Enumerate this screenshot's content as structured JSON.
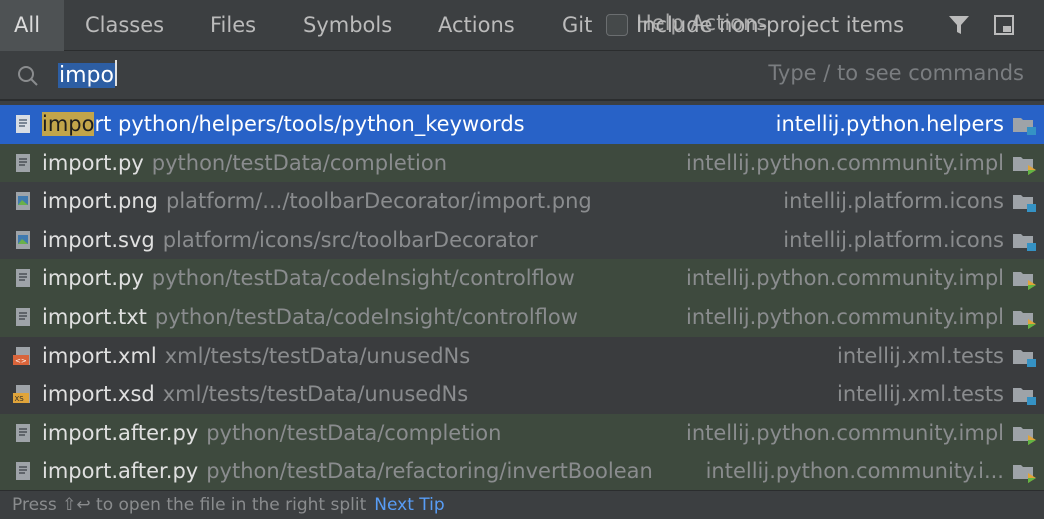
{
  "tabs": [
    {
      "label": "All",
      "active": true
    },
    {
      "label": "Classes"
    },
    {
      "label": "Files"
    },
    {
      "label": "Symbols"
    },
    {
      "label": "Actions"
    },
    {
      "label": "Git"
    }
  ],
  "include_checkbox": {
    "label": "Include non-project items",
    "checked": false
  },
  "overlap_label": "Help Actions",
  "toolbar_icons": [
    "filter-icon",
    "open-in-window-icon"
  ],
  "search": {
    "value_selected": "impo",
    "hint": "Type / to see commands"
  },
  "results": [
    {
      "icon": "python-file-icon",
      "match": "impo",
      "rest": "rt python/helpers/tools/python_keywords",
      "path": "",
      "module": "intellij.python.helpers",
      "style": "selected",
      "module_icon": "module-folder-icon"
    },
    {
      "icon": "text-file-icon",
      "match": "",
      "name": "import.py",
      "path": "python/testData/completion",
      "module": "intellij.python.community.impl",
      "style": "bg-green",
      "module_icon": "test-folder-icon"
    },
    {
      "icon": "image-file-icon",
      "match": "",
      "name": "import.png",
      "path": "platform/.../toolbarDecorator/import.png",
      "module": "intellij.platform.icons",
      "style": "bg-plain",
      "module_icon": "module-folder-icon"
    },
    {
      "icon": "image-file-icon",
      "match": "",
      "name": "import.svg",
      "path": "platform/icons/src/toolbarDecorator",
      "module": "intellij.platform.icons",
      "style": "bg-plain",
      "module_icon": "module-folder-icon"
    },
    {
      "icon": "text-file-icon",
      "match": "",
      "name": "import.py",
      "path": "python/testData/codeInsight/controlflow",
      "module": "intellij.python.community.impl",
      "style": "bg-green",
      "module_icon": "test-folder-icon"
    },
    {
      "icon": "text-file-icon",
      "match": "",
      "name": "import.txt",
      "path": "python/testData/codeInsight/controlflow",
      "module": "intellij.python.community.impl",
      "style": "bg-green",
      "module_icon": "test-folder-icon"
    },
    {
      "icon": "xml-file-icon",
      "match": "",
      "name": "import.xml",
      "path": "xml/tests/testData/unusedNs",
      "module": "intellij.xml.tests",
      "style": "bg-dark",
      "module_icon": "module-folder-icon"
    },
    {
      "icon": "xsd-file-icon",
      "match": "",
      "name": "import.xsd",
      "path": "xml/tests/testData/unusedNs",
      "module": "intellij.xml.tests",
      "style": "bg-dark",
      "module_icon": "module-folder-icon"
    },
    {
      "icon": "text-file-icon",
      "match": "",
      "name": "import.after.py",
      "path": "python/testData/completion",
      "module": "intellij.python.community.impl",
      "style": "bg-green",
      "module_icon": "test-folder-icon"
    },
    {
      "icon": "text-file-icon",
      "match": "",
      "name": "import.after.py",
      "path": "python/testData/refactoring/invertBoolean",
      "module": "intellij.python.community.i...",
      "style": "bg-green",
      "module_icon": "test-folder-icon"
    }
  ],
  "footer": {
    "text": "Press ⇧↩ to open the file in the right split",
    "tip": "Next Tip"
  }
}
